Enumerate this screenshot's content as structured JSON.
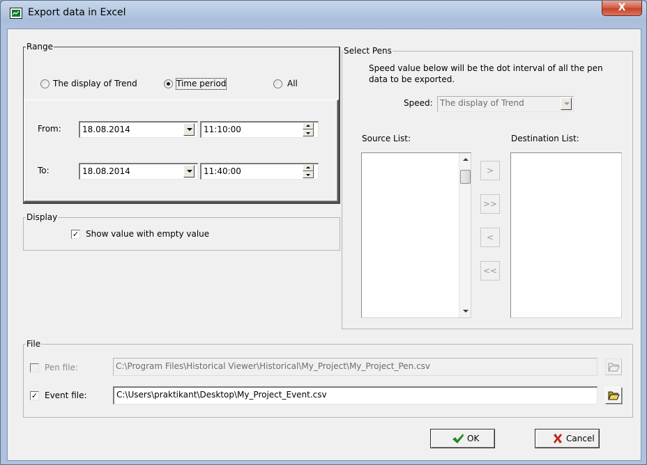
{
  "window": {
    "title": "Export data in Excel",
    "close_symbol": "X"
  },
  "range": {
    "group_label": "Range",
    "options": [
      {
        "label": "The display of Trend",
        "selected": false
      },
      {
        "label": "Time period",
        "selected": true
      },
      {
        "label": "All",
        "selected": false
      }
    ],
    "from": {
      "label": "From:",
      "date": "18.08.2014",
      "time": "11:10:00"
    },
    "to": {
      "label": "To:",
      "date": "18.08.2014",
      "time": "11:40:00"
    }
  },
  "display": {
    "group_label": "Display",
    "show_empty": {
      "label": "Show value with empty value",
      "checked": true
    }
  },
  "select_pens": {
    "group_label": "Select Pens",
    "hint_line1": "Speed value below will be the dot interval of all the pen",
    "hint_line2": "data to be exported.",
    "speed_label": "Speed:",
    "speed_value": "The display of Trend",
    "source_label": "Source List:",
    "destination_label": "Destination List:",
    "source_items": [],
    "destination_items": [],
    "move_buttons": [
      ">",
      ">>",
      "<",
      "<<"
    ]
  },
  "file": {
    "group_label": "File",
    "pen_file": {
      "label": "Pen file:",
      "checked": false,
      "enabled": false,
      "path": "C:\\Program Files\\Historical Viewer\\Historical\\My_Project\\My_Project_Pen.csv"
    },
    "event_file": {
      "label": "Event file:",
      "checked": true,
      "enabled": true,
      "path": "C:\\Users\\praktikant\\Desktop\\My_Project_Event.csv"
    }
  },
  "buttons": {
    "ok": "OK",
    "cancel": "Cancel"
  },
  "colors": {
    "ok_icon": "#1f8a1f",
    "cancel_icon": "#c0281b",
    "folder_icon": "#e8c23a"
  }
}
